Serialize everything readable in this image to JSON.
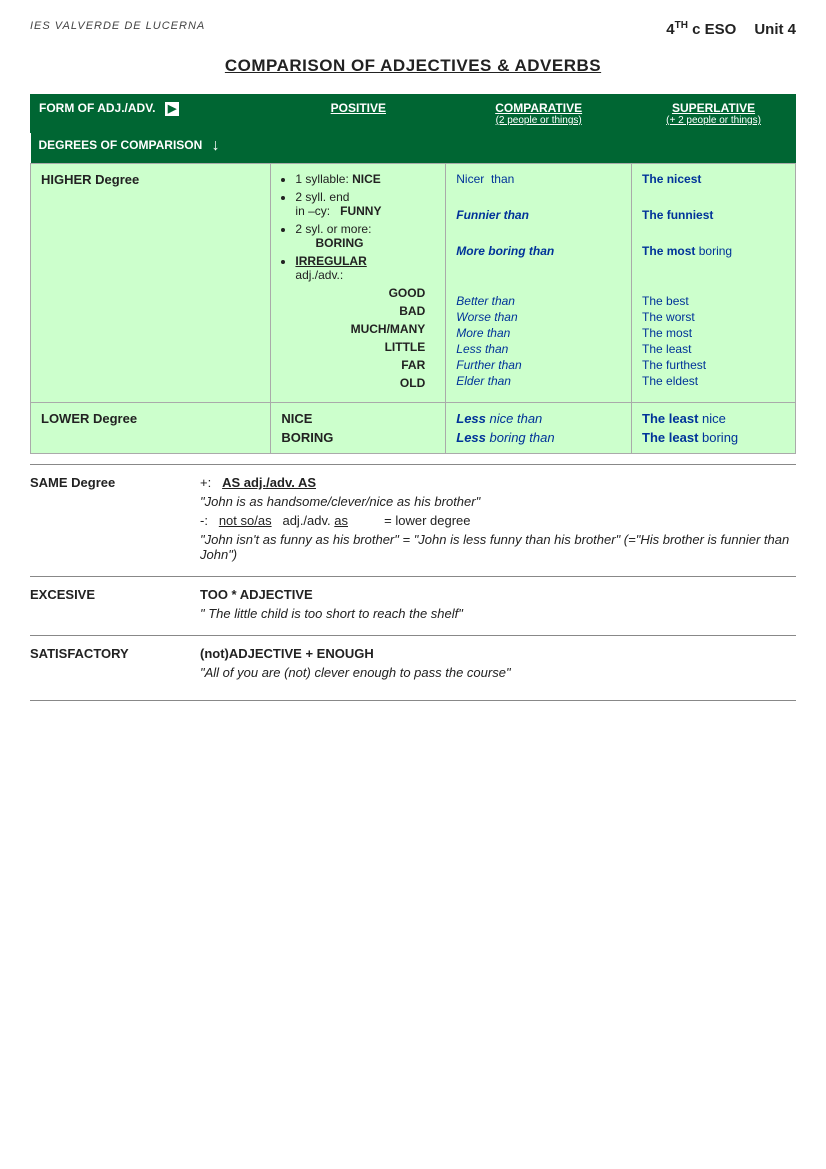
{
  "header": {
    "school": "IES VALVERDE DE LUCERNA",
    "grade": "4",
    "grade_sup": "TH",
    "class": "c ESO",
    "unit_label": "Unit 4"
  },
  "title": "COMPARISON OF ADJECTIVES & ADVERBS",
  "table": {
    "col_form": "FORM OF ADJ./ADV.",
    "col_positive": "POSITIVE",
    "col_comparative": "COMPARATIVE",
    "col_comparative_sub": "(2 people or things)",
    "col_superlative": "SUPERLATIVE",
    "col_superlative_sub": "(+ 2 people or things)",
    "degrees_label": "DEGREES OF COMPARISON"
  },
  "higher_degree": {
    "label": "HIGHER Degree",
    "rules": [
      "1 syllable: NICE",
      "2 syll. end in –cy:   FUNNY",
      "2 syl. or more:         BORING",
      "IRREGULAR adj./adv.:"
    ],
    "irregular_words": [
      "GOOD",
      "BAD",
      "MUCH/MANY",
      "LITTLE",
      "FAR",
      "OLD"
    ],
    "comparatives": [
      "Nicer  than",
      "Funnier than",
      "More boring than",
      "",
      "Better than",
      "Worse than",
      "More than",
      "Less than",
      "Further than",
      "Elder than"
    ],
    "superlatives": [
      "The nicest",
      "The funniest",
      "The most boring",
      "",
      "The best",
      "The worst",
      "The most",
      "The least",
      "The furthest",
      "The eldest"
    ]
  },
  "lower_degree": {
    "label": "LOWER Degree",
    "words": [
      "NICE",
      "BORING"
    ],
    "comparatives": [
      "Less nice than",
      "Less boring than"
    ],
    "superlatives": [
      "The least nice",
      "The least boring"
    ]
  },
  "same_degree": {
    "label": "SAME Degree",
    "plus_label": "+:",
    "plus_formula": "AS adj./adv. AS",
    "plus_example": "\"John is as handsome/clever/nice as his brother\"",
    "minus_label": "-:",
    "minus_formula": "not so/as",
    "minus_formula2": "adj./adv. as",
    "minus_meaning": "= lower degree",
    "minus_example": "\"John isn't as funny as his brother\" = \"John is less funny than his brother\" (=\"His brother is funnier than John\")"
  },
  "excessive": {
    "label": "EXCESIVE",
    "formula": "TOO * ADJECTIVE",
    "example": "\" The little child is too short to reach the shelf\""
  },
  "satisfactory": {
    "label": "SATISFACTORY",
    "formula": "(not)ADJECTIVE + ENOUGH",
    "example": "\"All of you are (not) clever enough to pass the course\""
  }
}
